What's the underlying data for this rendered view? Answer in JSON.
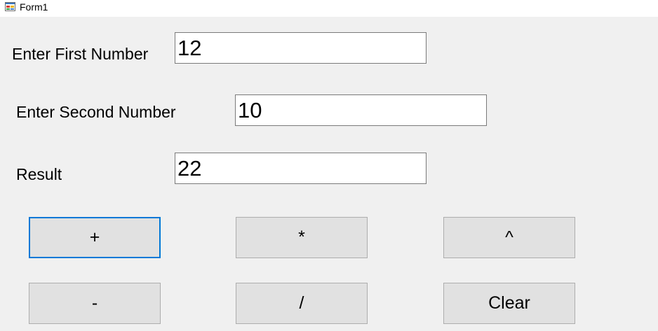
{
  "window": {
    "title": "Form1",
    "icon": "winforms-app-icon"
  },
  "form": {
    "first_label": "Enter First Number",
    "first_value": "12",
    "second_label": "Enter Second Number",
    "second_value": "10",
    "result_label": "Result",
    "result_value": "22"
  },
  "buttons": {
    "add": "+",
    "multiply": "*",
    "power": "^",
    "subtract": "-",
    "divide": "/",
    "clear": "Clear"
  },
  "colors": {
    "form_background": "#f0f0f0",
    "button_face": "#e1e1e1",
    "focus_border": "#0078d7"
  }
}
